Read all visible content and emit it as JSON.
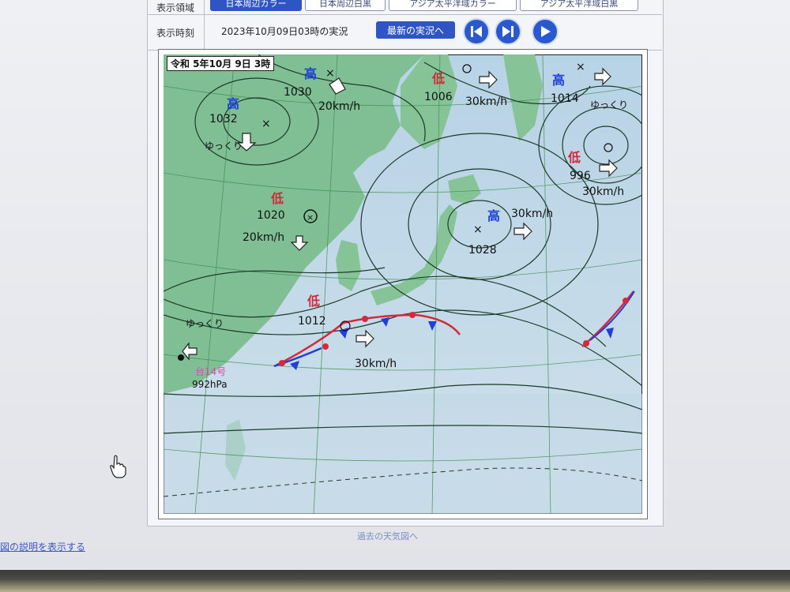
{
  "display_region": {
    "label": "表示領域",
    "buttons": [
      "日本周辺カラー",
      "日本周辺白黒",
      "アジア太平洋域カラー",
      "アジア太平洋域白黒"
    ],
    "active_index": 0
  },
  "display_time": {
    "label": "表示時刻",
    "value": "2023年10月09日03時の実況",
    "latest_button": "最新の実況へ"
  },
  "controls": {
    "first": "skip-to-first-icon",
    "previous": "step-back-icon",
    "play": "play-icon"
  },
  "map": {
    "date_label": "令和 5年10月 9日 3時",
    "highs": [
      {
        "label": "高",
        "pressure": "1030",
        "motion": "20km/h"
      },
      {
        "label": "高",
        "pressure": "1032",
        "motion": "ゆっくり"
      },
      {
        "label": "高",
        "pressure": "1028",
        "motion": "30km/h"
      },
      {
        "label": "高",
        "pressure": "1014",
        "motion": "ゆっくり"
      }
    ],
    "lows": [
      {
        "label": "低",
        "pressure": "1006",
        "motion": "30km/h"
      },
      {
        "label": "低",
        "pressure": "1020",
        "motion": "20km/h"
      },
      {
        "label": "低",
        "pressure": "996",
        "motion": "30km/h"
      },
      {
        "label": "低",
        "pressure": "1012",
        "motion": "30km/h"
      }
    ],
    "typhoon": {
      "label": "台14号",
      "pressure": "992hPa",
      "motion": "ゆっくり"
    }
  },
  "footer_link": "過去の天気図へ",
  "left_link": "図の説明を表示する",
  "colors": {
    "accent": "#2f54c3",
    "high": "#1f3fd6",
    "low": "#d6283c"
  }
}
